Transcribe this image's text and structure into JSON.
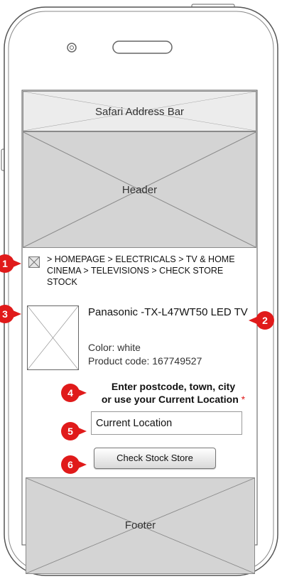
{
  "address_bar": {
    "label": "Safari Address Bar"
  },
  "header": {
    "label": "Header"
  },
  "breadcrumb": {
    "text": "> HOMEPAGE > ELECTRICALS > TV & HOME CINEMA > TELEVISIONS > ",
    "current": "CHECK STORE STOCK"
  },
  "product": {
    "title": "Panasonic -TX-L47WT50 LED TV",
    "color": "Color: white",
    "code": "Product code: 167749527"
  },
  "location": {
    "prompt_line1": "Enter postcode, town, city",
    "prompt_line2": "or use your Current Location",
    "required_mark": "*",
    "input_value": "Current Location"
  },
  "check_button": {
    "label": "Check Stock Store"
  },
  "footer": {
    "label": "Footer"
  },
  "annotations": [
    "1",
    "2",
    "3",
    "4",
    "5",
    "6"
  ],
  "colors": {
    "annotation": "#e01a1a",
    "placeholder_fill": "#d4d4d4",
    "outline": "#555555"
  }
}
